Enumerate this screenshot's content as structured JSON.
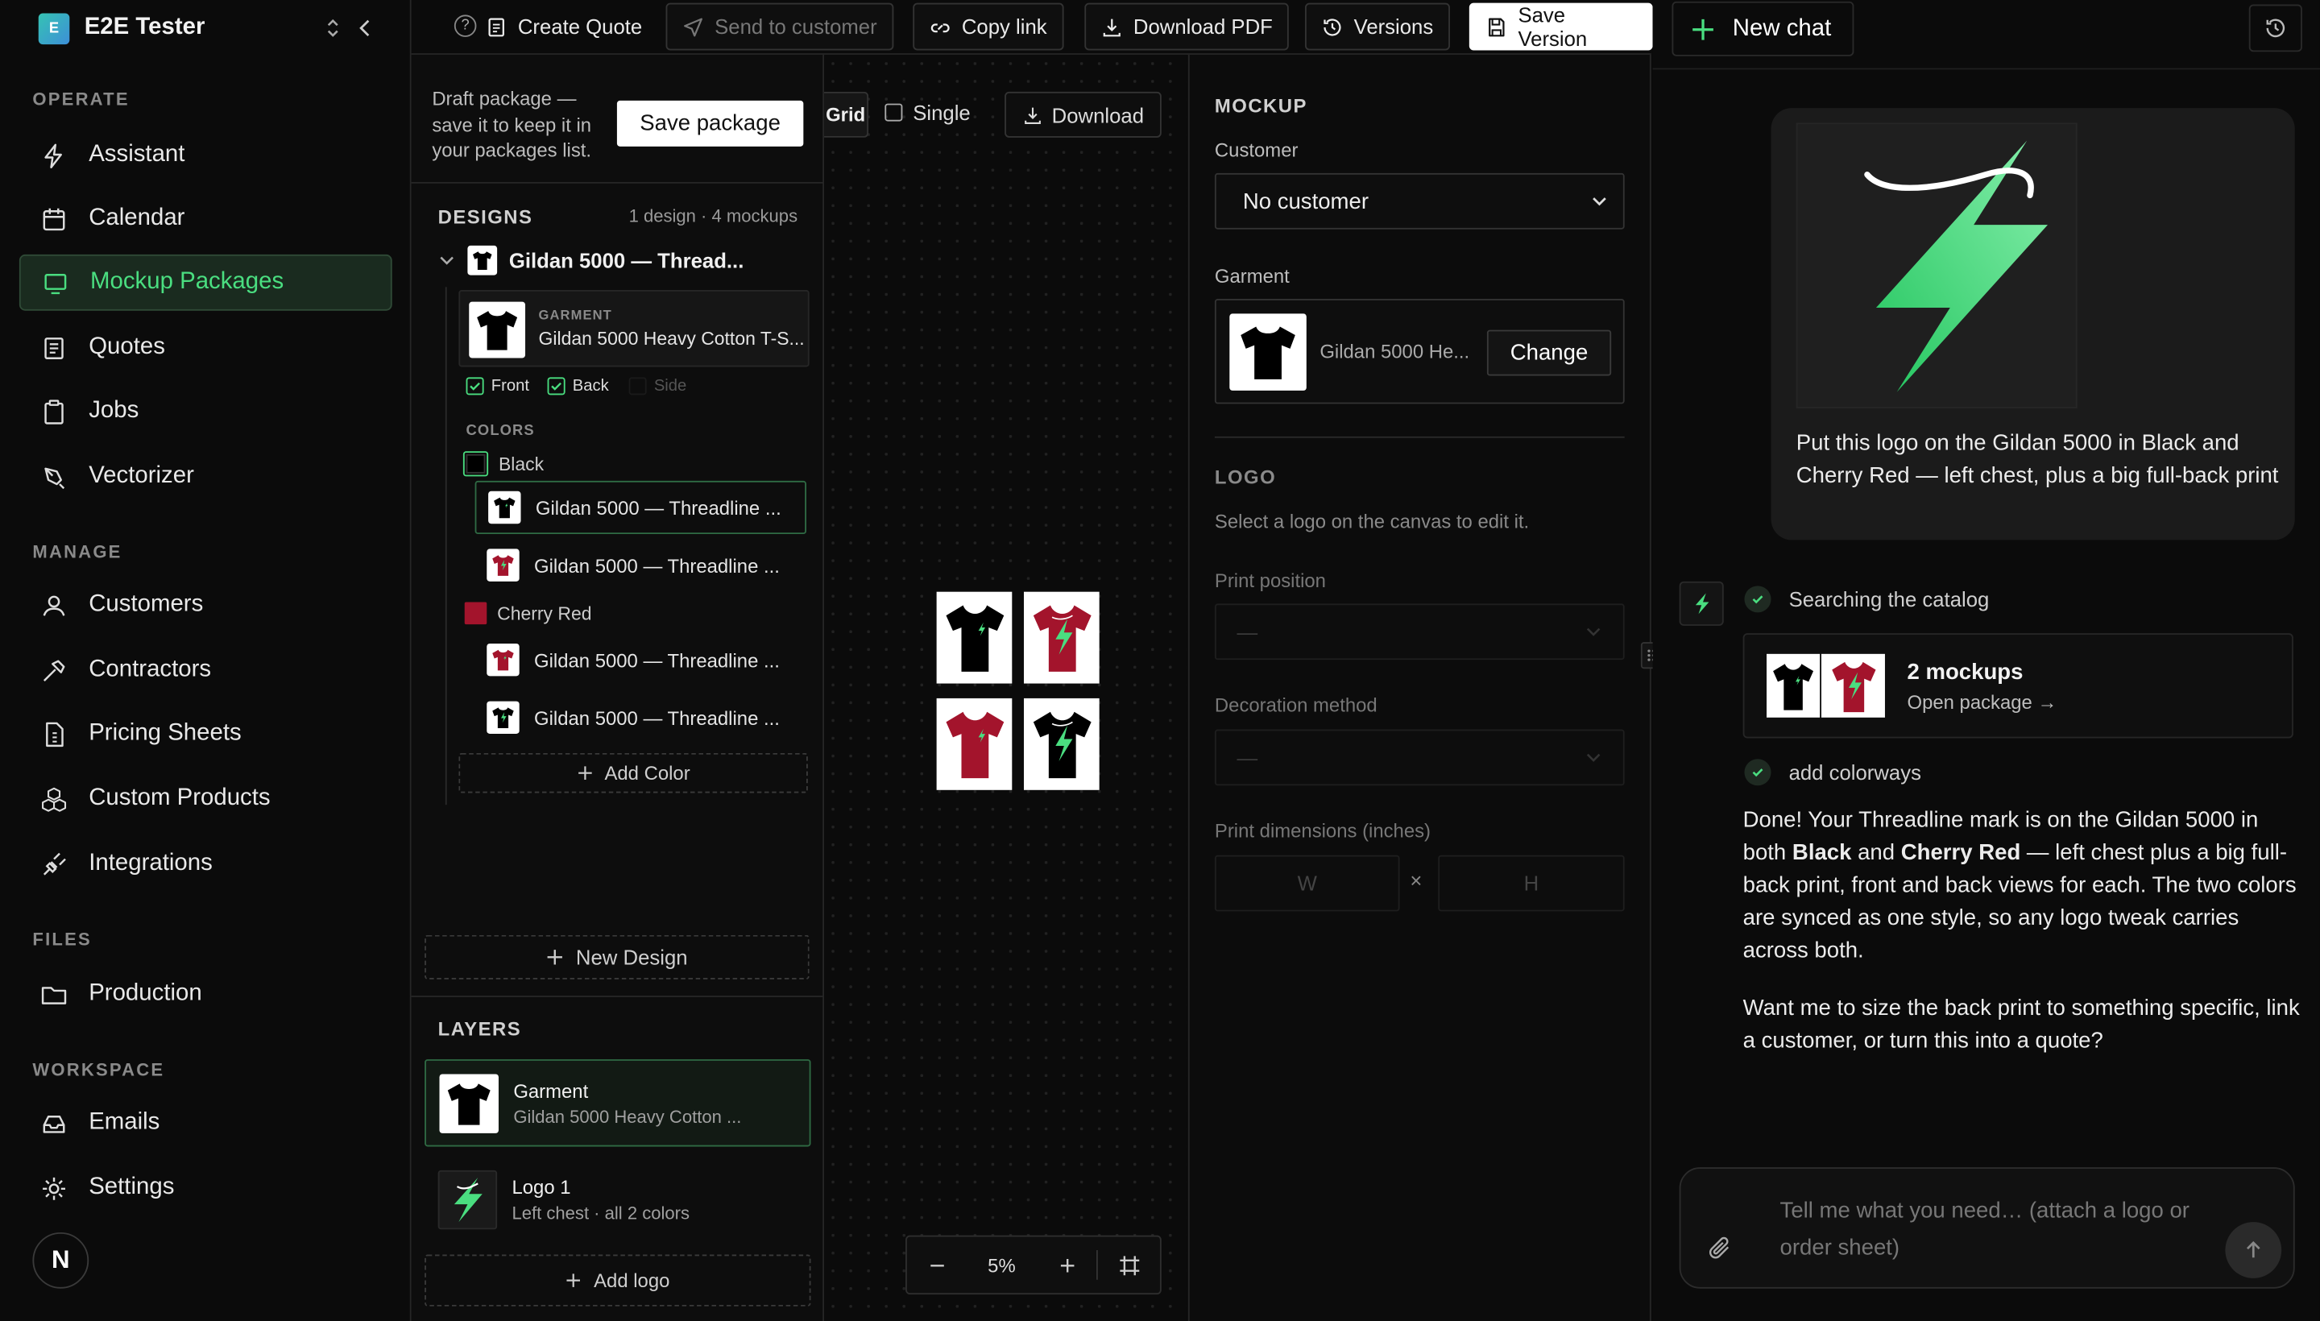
{
  "sidebar": {
    "brand_initials": "E",
    "brand_name": "E2E Tester",
    "sections": {
      "operate": "OPERATE",
      "manage": "MANAGE",
      "files": "FILES",
      "workspace": "WORKSPACE"
    },
    "operate_items": [
      "Assistant",
      "Calendar",
      "Mockup Packages",
      "Quotes",
      "Jobs",
      "Vectorizer"
    ],
    "manage_items": [
      "Customers",
      "Contractors",
      "Pricing Sheets",
      "Custom Products",
      "Integrations"
    ],
    "files_items": [
      "Production"
    ],
    "workspace_items": [
      "Emails",
      "Settings"
    ],
    "avatar_initial": "N",
    "accent_color": "#4ade80"
  },
  "toolbar": {
    "create_quote": "Create Quote",
    "send_to_customer": "Send to customer",
    "copy_link": "Copy link",
    "download_pdf": "Download PDF",
    "versions": "Versions",
    "save_version": "Save Version"
  },
  "draft": {
    "text": "Draft package — save it to keep it in your packages list.",
    "save_package": "Save package"
  },
  "designs": {
    "title": "DESIGNS",
    "summary": "1 design · 4 mockups",
    "design_name": "Gildan 5000 — Thread...",
    "garment_label": "GARMENT",
    "garment_name": "Gildan 5000 Heavy Cotton T-S...",
    "views": [
      "Front",
      "Back",
      "Side"
    ],
    "colors_label": "COLORS",
    "color_groups": [
      {
        "name": "Black",
        "swatch": "#000000",
        "items": [
          "Gildan 5000 — Threadline ...",
          "Gildan 5000 — Threadline ..."
        ]
      },
      {
        "name": "Cherry Red",
        "swatch": "#a3142c",
        "items": [
          "Gildan 5000 — Threadline ...",
          "Gildan 5000 — Threadline ..."
        ]
      }
    ],
    "add_color": "Add Color",
    "new_design": "New Design"
  },
  "layers": {
    "title": "LAYERS",
    "items": [
      {
        "name": "Garment",
        "sub": "Gildan 5000 Heavy Cotton ..."
      },
      {
        "name": "Logo 1",
        "sub": "Left chest · all 2 colors"
      }
    ],
    "add_logo": "Add logo"
  },
  "canvas": {
    "view_grid": "Grid",
    "view_single": "Single",
    "download": "Download",
    "zoom": "5%"
  },
  "form": {
    "mockup_title": "MOCKUP",
    "customer_label": "Customer",
    "customer_value": "No customer",
    "garment_label": "Garment",
    "garment_value": "Gildan 5000 He...",
    "change": "Change",
    "logo_title": "LOGO",
    "logo_hint": "Select a logo on the canvas to edit it.",
    "print_position": "Print position",
    "decoration_method": "Decoration method",
    "dash": "—",
    "print_dimensions": "Print dimensions (inches)",
    "w": "W",
    "h": "H",
    "times": "×"
  },
  "chat": {
    "new_chat": "New chat",
    "user_message": "Put this logo on the Gildan 5000 in Black and Cherry Red — left chest, plus a big full-back print",
    "step1": "Searching the catalog",
    "card_title": "2 mockups",
    "card_link": "Open package →",
    "step2": "add colorways",
    "reply_p1_a": "Done! Your Threadline mark is on the Gildan 5000 in both ",
    "reply_p1_b1": "Black",
    "reply_p1_and": " and ",
    "reply_p1_b2": "Cherry Red",
    "reply_p1_c": " — left chest plus a big full-back print, front and back views for each. The two colors are synced as one style, so any logo tweak carries across both.",
    "reply_p2": "Want me to size the back print to something specific, link a customer, or turn this into a quote?",
    "input_placeholder": "Tell me what you need… (attach a logo or order sheet)"
  }
}
